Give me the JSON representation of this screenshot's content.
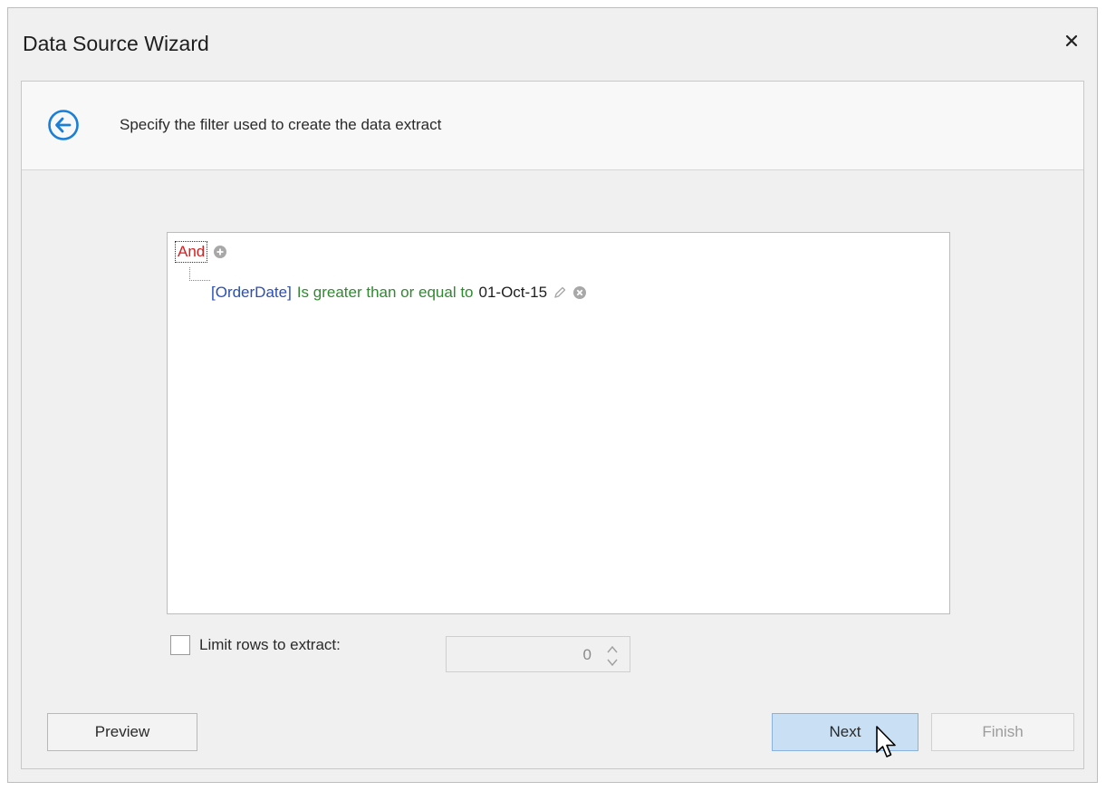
{
  "window": {
    "title": "Data Source Wizard"
  },
  "header": {
    "description": "Specify the filter used to create the data extract"
  },
  "filter": {
    "group_operator": "And",
    "conditions": [
      {
        "field": "[OrderDate]",
        "operator": "Is greater than or equal to",
        "value": "01-Oct-15"
      }
    ]
  },
  "limit": {
    "label": "Limit rows to extract:",
    "checked": false,
    "value": "0"
  },
  "buttons": {
    "preview": "Preview",
    "next": "Next",
    "finish": "Finish"
  },
  "colors": {
    "accent": "#1a7fd6",
    "group_operator": "#d42020",
    "field": "#2b4fb5",
    "operator": "#2f8a2f",
    "next_button_bg": "#c9dff4"
  },
  "icons": {
    "close": "close-icon",
    "back": "back-arrow-icon",
    "add_condition": "plus-circle-icon",
    "edit_value": "pencil-icon",
    "remove_condition": "remove-circle-icon",
    "spin_up": "chevron-up-icon",
    "spin_down": "chevron-down-icon"
  }
}
